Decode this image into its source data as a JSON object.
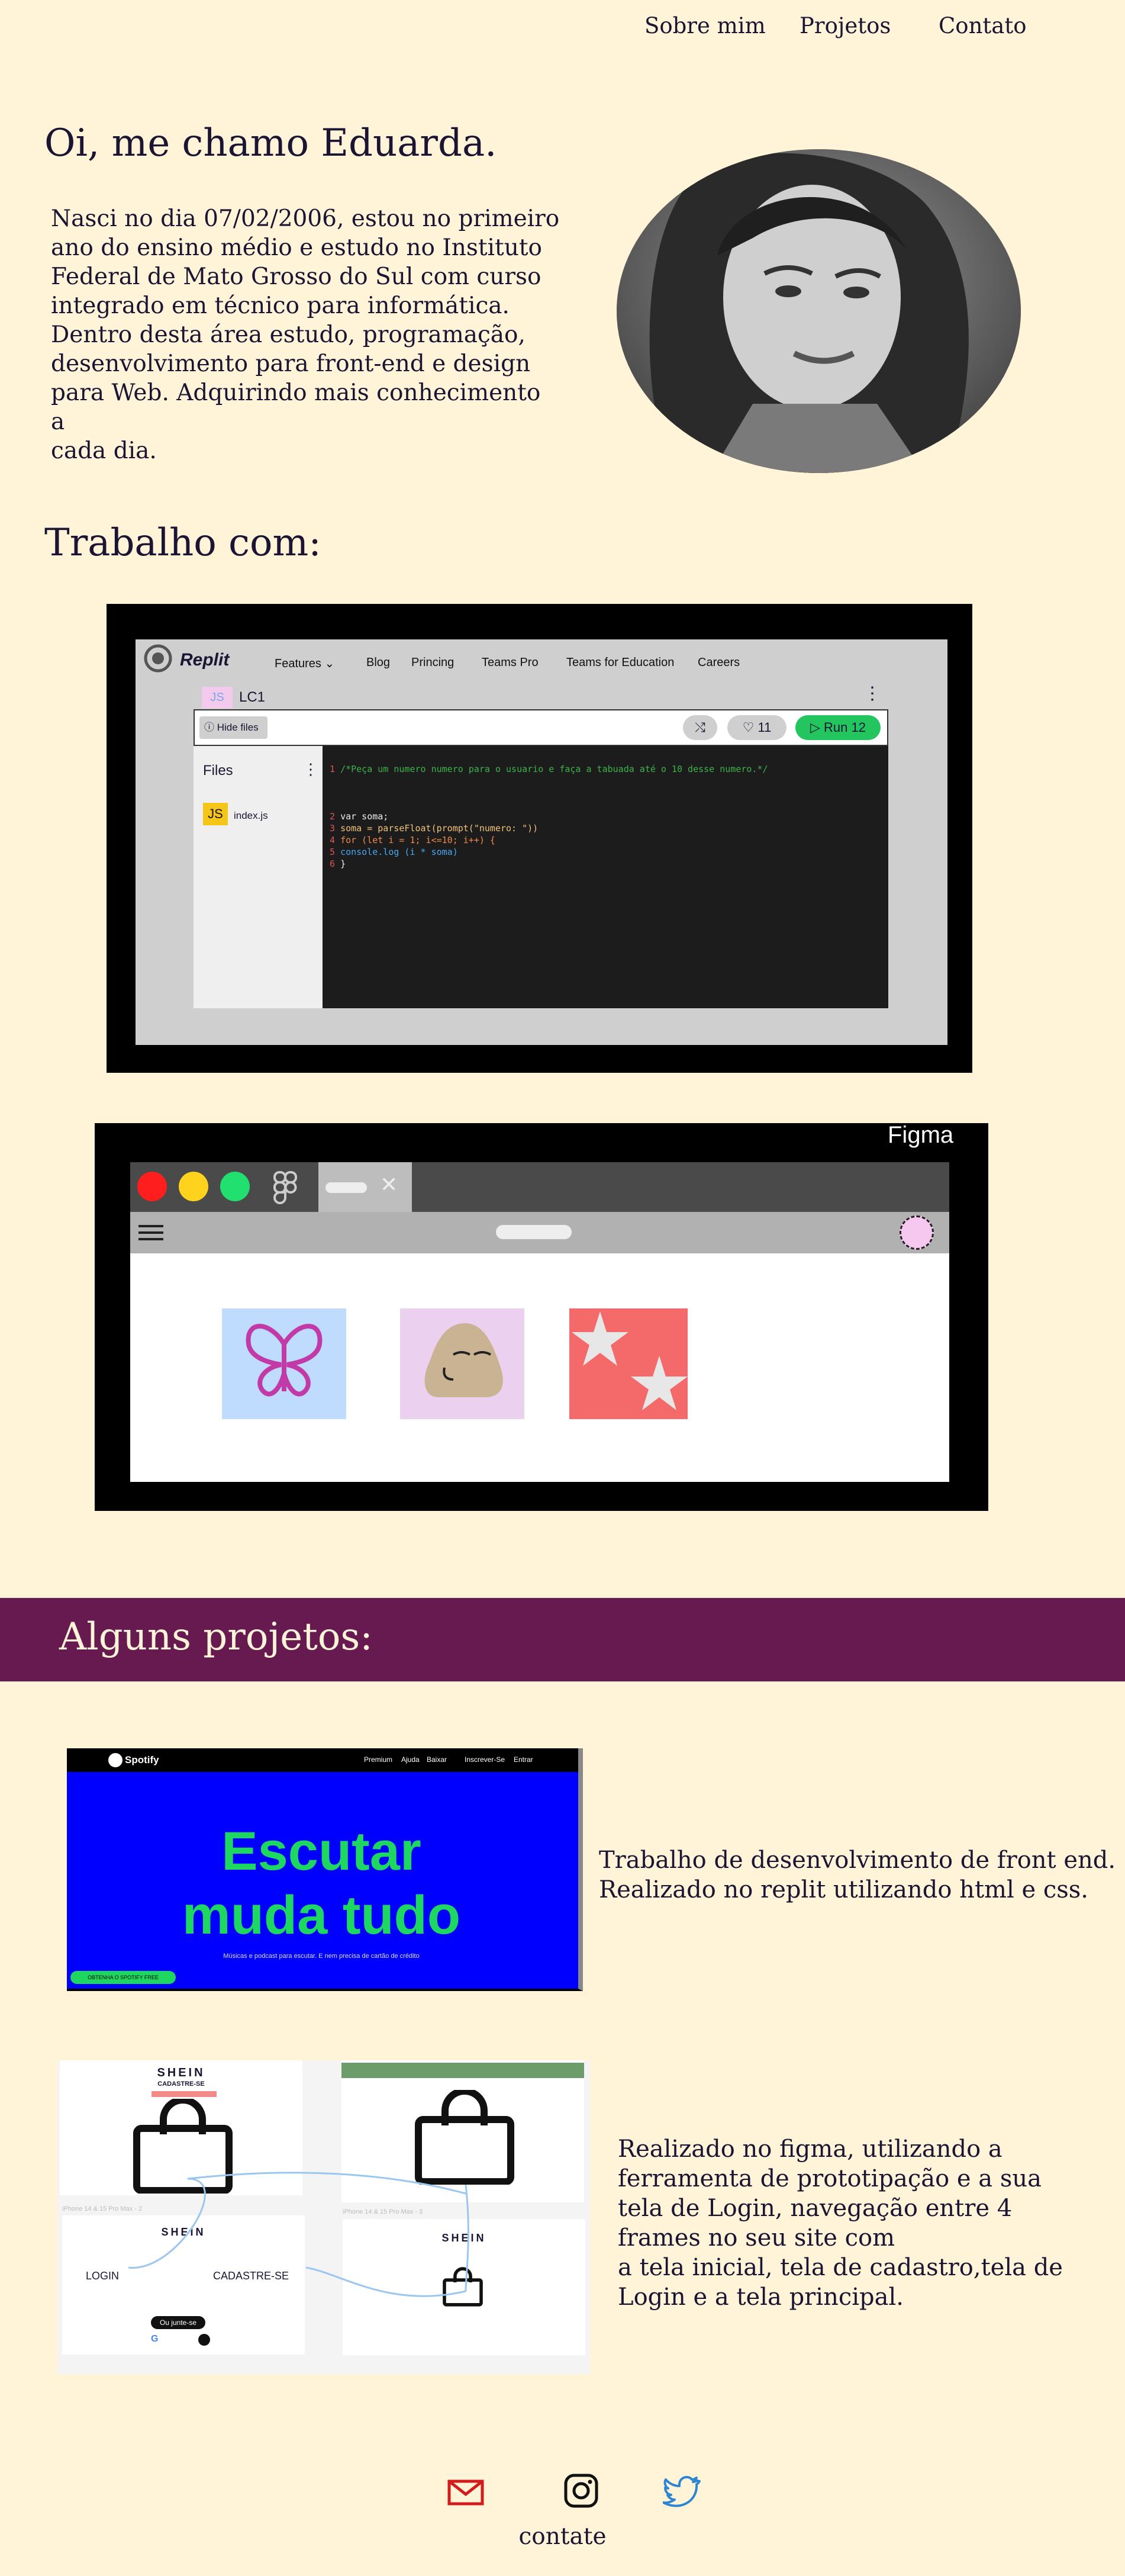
{
  "nav": {
    "about": "Sobre mim",
    "projects": "Projetos",
    "contact": "Contato"
  },
  "hero": {
    "title": "Oi, me chamo Eduarda.",
    "text_lines": [
      "Nasci no dia 07/02/2006, estou no primeiro",
      "ano do ensino médio e estudo no Instituto",
      "Federal de Mato Grosso do Sul com curso",
      "integrado em técnico para informática.",
      "Dentro desta área estudo, programação,",
      "desenvolvimento para front-end e design",
      "para Web. Adquirindo mais conhecimento a",
      "cada dia."
    ]
  },
  "work": {
    "title": "Trabalho  com:",
    "replit": {
      "logo": "Replit",
      "menu": [
        "Features",
        "Blog",
        "Princing",
        "Teams Pro",
        "Teams for Education",
        "Careers"
      ],
      "repl_name": "LC1",
      "repl_badge": "JS",
      "hide_files": "Hide files",
      "likes": "11",
      "run": "Run 12",
      "files_title": "Files",
      "file_badge": "JS",
      "file_name": "index.js",
      "code": [
        {
          "n": "1",
          "text": "/*Peça um numero numero para o usuario e faça a tabuada até o 10 desse numero.*/"
        },
        {
          "n": "",
          "text": ""
        },
        {
          "n": "",
          "text": ""
        },
        {
          "n": "2",
          "text": "var soma;"
        },
        {
          "n": "3",
          "text": "soma = parseFloat(prompt(\"numero: \"))"
        },
        {
          "n": "4",
          "text": "for (let i = 1; i<=10; i++) {"
        },
        {
          "n": "5",
          "text": "  console.log (i * soma)"
        },
        {
          "n": "6",
          "text": "}"
        }
      ]
    },
    "figma": {
      "brand": "Figma"
    }
  },
  "projects": {
    "title": "Alguns projetos:",
    "spotify": {
      "brand": "Spotify",
      "menu": [
        "Premium",
        "Ajuda",
        "Baixar",
        "Inscrever-Se",
        "Entrar"
      ],
      "headline_1": "Escutar",
      "headline_2": "muda tudo",
      "sub": "Músicas e podcast para escutar. E nem precisa de cartão de crédito",
      "cta": "OBTENHA O SPOTIFY FREE"
    },
    "spotify_desc": [
      "Trabalho de desenvolvimento de front end.",
      "Realizado no replit utilizando html e css."
    ],
    "shein": {
      "brand": "SHEIN",
      "tagline": "CADASTRE-SE",
      "frame_label_1": "iPhone 14 & 15 Pro Max - 2",
      "frame_label_2": "iPhone 14 & 15 Pro Max - 3",
      "login": "LOGIN",
      "signup": "CADASTRE-SE",
      "join": "Ou junte-se",
      "login_btn": "Login"
    },
    "figma_desc": [
      "Realizado no figma, utilizando a",
      "ferramenta de prototipação e a sua",
      "tela de Login, navegação entre 4",
      "frames no seu site com",
      "a tela inicial, tela de cadastro,tela de",
      "Login e a tela principal."
    ]
  },
  "footer": {
    "contact_label": "contate"
  },
  "colors": {
    "background": "#fff3d8",
    "band": "#661a50",
    "text": "#1b1533",
    "spotify_green": "#1ed760",
    "spotify_blue": "#0000ff",
    "run_green": "#22c55e"
  }
}
